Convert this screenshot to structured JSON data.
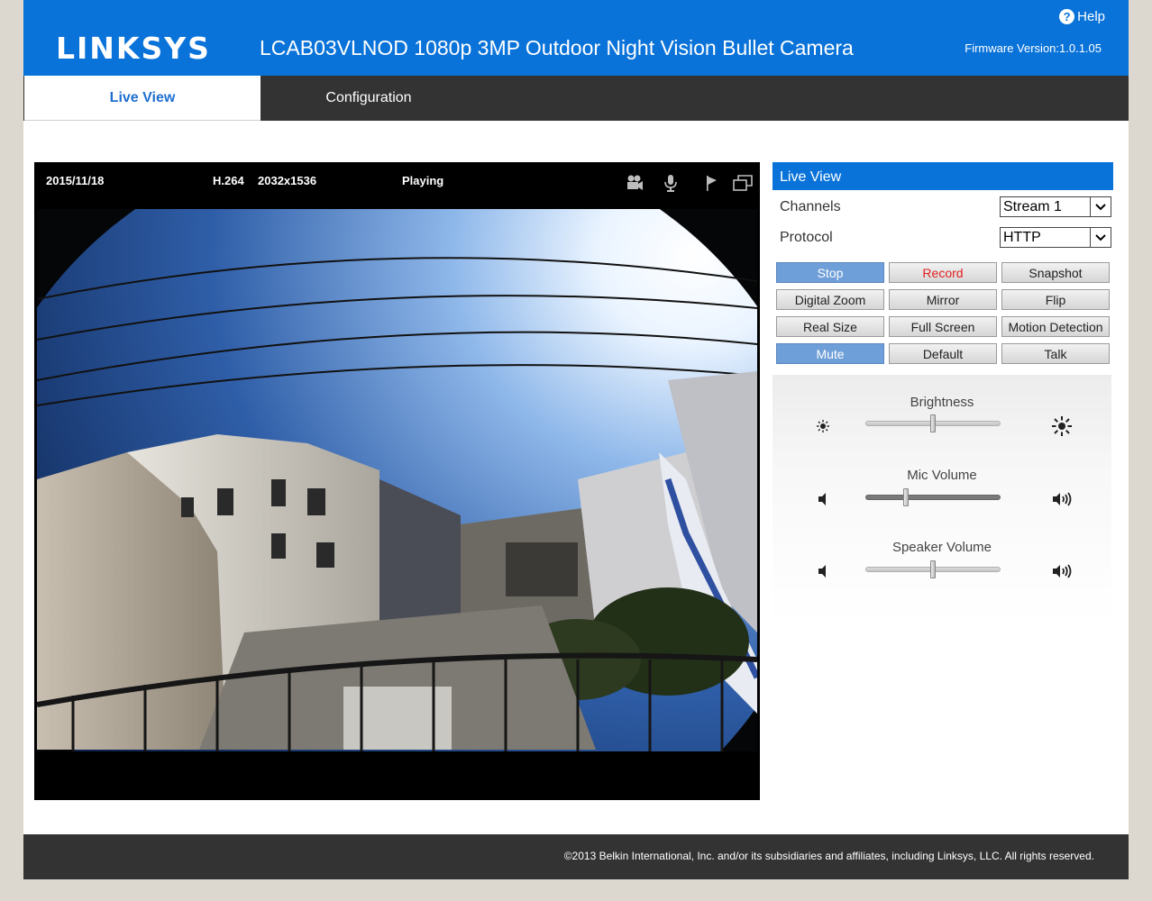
{
  "header": {
    "brand": "LINKSYS",
    "title": "LCAB03VLNOD 1080p 3MP Outdoor Night Vision Bullet Camera",
    "help_label": "Help",
    "firmware": "Firmware Version:1.0.1.05"
  },
  "tabs": [
    {
      "label": "Live View",
      "active": true
    },
    {
      "label": "Configuration",
      "active": false
    }
  ],
  "video": {
    "date": "2015/11/18",
    "codec": "H.264",
    "resolution": "2032x1536",
    "status": "Playing",
    "icons": [
      "video-record-icon",
      "microphone-icon",
      "flag-icon",
      "window-icon"
    ]
  },
  "panel": {
    "title": "Live View",
    "channels_label": "Channels",
    "channels_value": "Stream 1",
    "protocol_label": "Protocol",
    "protocol_value": "HTTP",
    "buttons": [
      "Stop",
      "Record",
      "Snapshot",
      "Digital Zoom",
      "Mirror",
      "Flip",
      "Real Size",
      "Full Screen",
      "Motion Detection",
      "Mute",
      "Default",
      "Talk"
    ],
    "sliders": [
      {
        "label": "Brightness",
        "level": 0.5
      },
      {
        "label": "Mic Volume",
        "level": 0.3
      },
      {
        "label": "Speaker Volume",
        "level": 0.5
      }
    ]
  },
  "colors": {
    "brand_blue": "#0a73d9",
    "active_button": "#6f9fd8",
    "record_text": "#e02020",
    "dark_bar": "#333333"
  },
  "footer": {
    "copyright": "©2013 Belkin International, Inc. and/or its subsidiaries and affiliates, including Linksys, LLC. All rights reserved."
  }
}
